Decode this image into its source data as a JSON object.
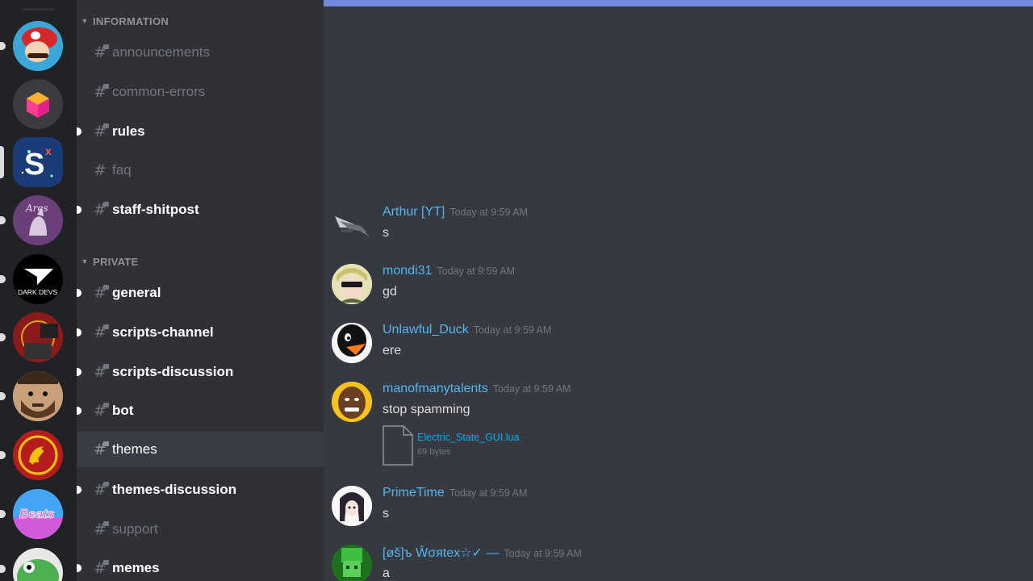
{
  "servers": [
    {
      "name": "mario-server-icon"
    },
    {
      "name": "cube-server-icon"
    },
    {
      "name": "sx-server-icon",
      "label": "S"
    },
    {
      "name": "ares-server-icon",
      "label": "Ares"
    },
    {
      "name": "darkdevs-server-icon",
      "label": "DARK DEVS"
    },
    {
      "name": "red-star-server-icon"
    },
    {
      "name": "bearded-face-server-icon"
    },
    {
      "name": "hammer-sickle-server-icon"
    },
    {
      "name": "beats-server-icon",
      "label": "Beats"
    },
    {
      "name": "frog-server-icon"
    }
  ],
  "categories": {
    "information": "INFORMATION",
    "private": "PRIVATE"
  },
  "channels": [
    {
      "label": "announcements"
    },
    {
      "label": "common-errors"
    },
    {
      "label": "rules"
    },
    {
      "label": "faq"
    },
    {
      "label": "staff-shitpost"
    },
    {
      "label": "general"
    },
    {
      "label": "scripts-channel"
    },
    {
      "label": "scripts-discussion"
    },
    {
      "label": "bot"
    },
    {
      "label": "themes"
    },
    {
      "label": "themes-discussion"
    },
    {
      "label": "support"
    },
    {
      "label": "memes"
    }
  ],
  "messages": [
    {
      "author": "Arthur [YT]",
      "timestamp": "Today at 9:59 AM",
      "text": "s"
    },
    {
      "author": "mondi31",
      "timestamp": "Today at 9:59 AM",
      "text": "gd"
    },
    {
      "author": "Unlawful_Duck",
      "timestamp": "Today at 9:59 AM",
      "text": "ere"
    },
    {
      "author": "manofmanytalents",
      "timestamp": "Today at 9:59 AM",
      "text": "stop spamming",
      "attachment": {
        "filename": "Electric_State_GUI.lua",
        "size": "69 bytes"
      }
    },
    {
      "author": "PrimeTime",
      "timestamp": "Today at 9:59 AM",
      "text": "s"
    },
    {
      "author": "[øš]ъ Ŵσяtex☆✓ —",
      "timestamp": "Today at 9:59 AM",
      "text": "a"
    }
  ],
  "colors": {
    "accent": "#7289da",
    "username": "#52b6f3",
    "link": "#00b0f4"
  }
}
